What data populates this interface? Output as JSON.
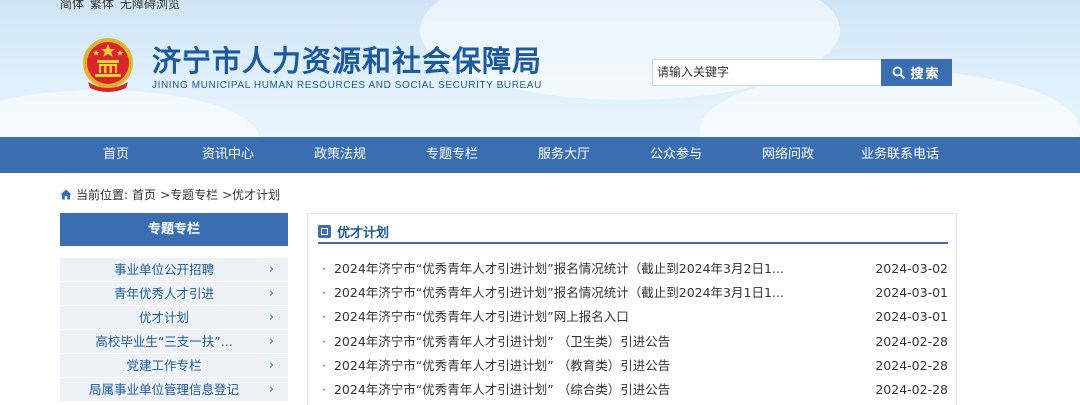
{
  "top_links": [
    "简体",
    "繁体",
    "无障碍浏览"
  ],
  "site": {
    "title": "济宁市人力资源和社会保障局",
    "subtitle": "JINING MUNICIPAL HUMAN RESOURCES AND SOCIAL SECURITY BUREAU"
  },
  "search": {
    "value": "请输入关键字",
    "button_label": "搜索"
  },
  "nav": [
    "首页",
    "资讯中心",
    "政策法规",
    "专题专栏",
    "服务大厅",
    "公众参与",
    "网络问政",
    "业务联系电话"
  ],
  "breadcrumb": {
    "prefix": "当前位置:",
    "items": [
      "首页",
      ">专题专栏",
      ">优才计划"
    ]
  },
  "sidebar": {
    "title": "专题专栏",
    "items": [
      "事业单位公开招聘",
      "青年优秀人才引进",
      "优才计划",
      "高校毕业生“三支一扶”...",
      "党建工作专栏",
      "局属事业单位管理信息登记"
    ]
  },
  "main": {
    "title": "优才计划",
    "articles": [
      {
        "title": "2024年济宁市“优秀青年人才引进计划”报名情况统计（截止到2024年3月2日1...",
        "date": "2024-03-02"
      },
      {
        "title": "2024年济宁市“优秀青年人才引进计划”报名情况统计（截止到2024年3月1日1...",
        "date": "2024-03-01"
      },
      {
        "title": "2024年济宁市“优秀青年人才引进计划”网上报名入口",
        "date": "2024-03-01"
      },
      {
        "title": "2024年济宁市“优秀青年人才引进计划” （卫生类）引进公告",
        "date": "2024-02-28"
      },
      {
        "title": "2024年济宁市“优秀青年人才引进计划” （教育类）引进公告",
        "date": "2024-02-28"
      },
      {
        "title": "2024年济宁市“优秀青年人才引进计划” （综合类）引进公告",
        "date": "2024-02-28"
      }
    ]
  },
  "colors": {
    "brand_blue": "#3a6eb0",
    "title_blue": "#1d5a9a"
  },
  "icons": {
    "emblem": "national-emblem",
    "search": "search-icon",
    "home": "home-icon",
    "section": "square-icon",
    "arrow": "chevron-right-icon"
  }
}
